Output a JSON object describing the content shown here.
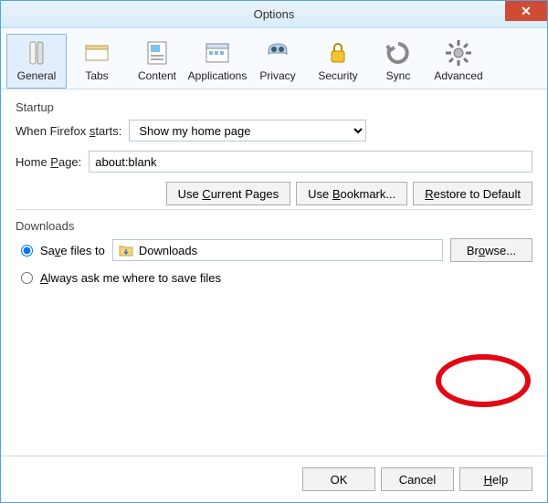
{
  "window": {
    "title": "Options"
  },
  "tabs": {
    "general": "General",
    "tabs": "Tabs",
    "content": "Content",
    "applications": "Applications",
    "privacy": "Privacy",
    "security": "Security",
    "sync": "Sync",
    "advanced": "Advanced"
  },
  "startup": {
    "group_label": "Startup",
    "when_label": "When Firefox starts:",
    "when_value": "Show my home page",
    "home_label": "Home Page:",
    "home_value": "about:blank",
    "btn_current": "Use Current Pages",
    "btn_bookmark": "Use Bookmark...",
    "btn_restore": "Restore to Default"
  },
  "downloads": {
    "group_label": "Downloads",
    "save_to_label": "Save files to",
    "path_value": "Downloads",
    "browse_label": "Browse...",
    "always_ask_label": "Always ask me where to save files"
  },
  "footer": {
    "ok": "OK",
    "cancel": "Cancel",
    "help": "Help"
  }
}
